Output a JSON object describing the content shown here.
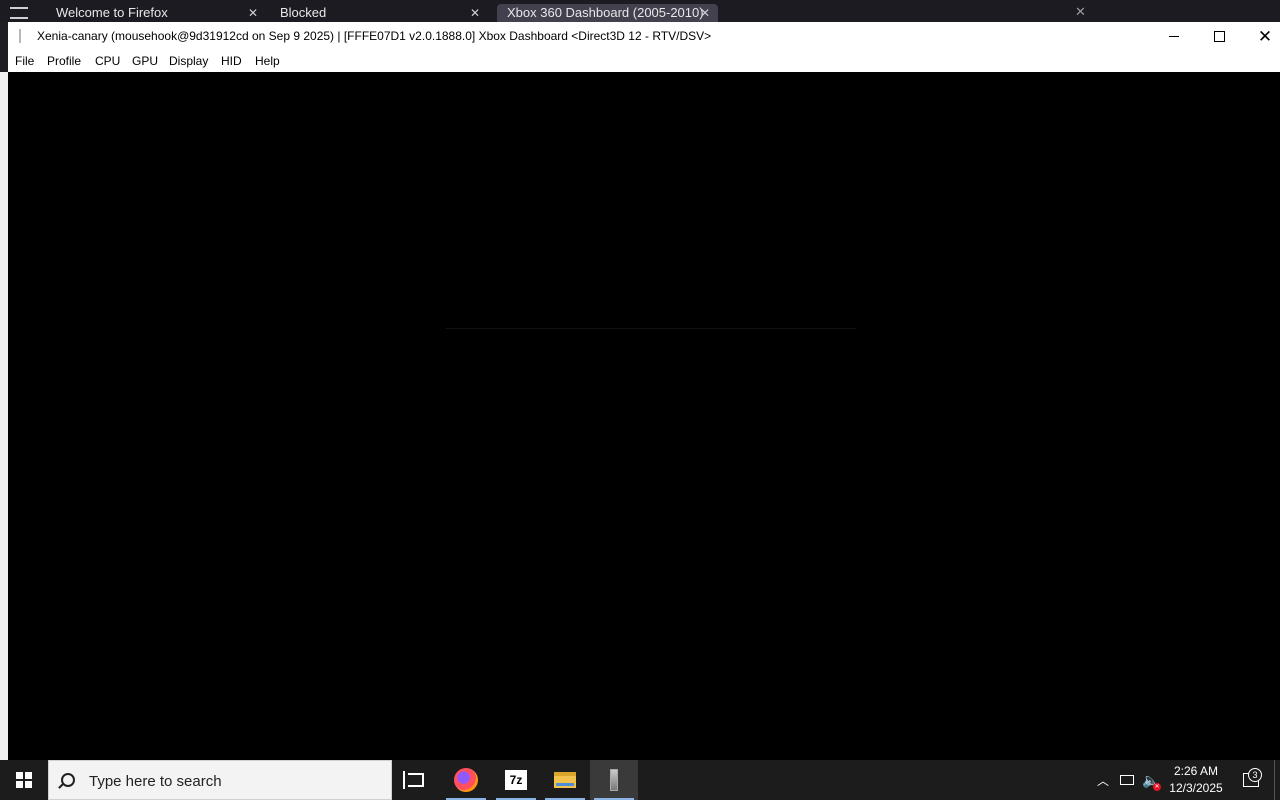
{
  "background_browser": {
    "tabs": [
      {
        "label": "Welcome to Firefox"
      },
      {
        "label": "Blocked"
      },
      {
        "label": "Xbox 360 Dashboard (2005-2010)"
      }
    ]
  },
  "window": {
    "title": "Xenia-canary (mousehook@9d31912cd on Sep  9 2025) | [FFFE07D1 v2.0.1888.0] Xbox Dashboard <Direct3D 12 - RTV/DSV>",
    "menu": [
      "File",
      "Profile",
      "CPU",
      "GPU",
      "Display",
      "HID",
      "Help"
    ]
  },
  "taskbar": {
    "search_placeholder": "Type here to search",
    "apps": [
      "task-view",
      "firefox",
      "7-zip",
      "file-explorer",
      "xenia"
    ],
    "clock_time": "2:26 AM",
    "clock_date": "12/3/2025",
    "notification_count": "3"
  },
  "colors": {
    "taskbar_bg": "#1c1c1c",
    "active_underline": "#8ab4e8",
    "render_bg": "#000000"
  }
}
